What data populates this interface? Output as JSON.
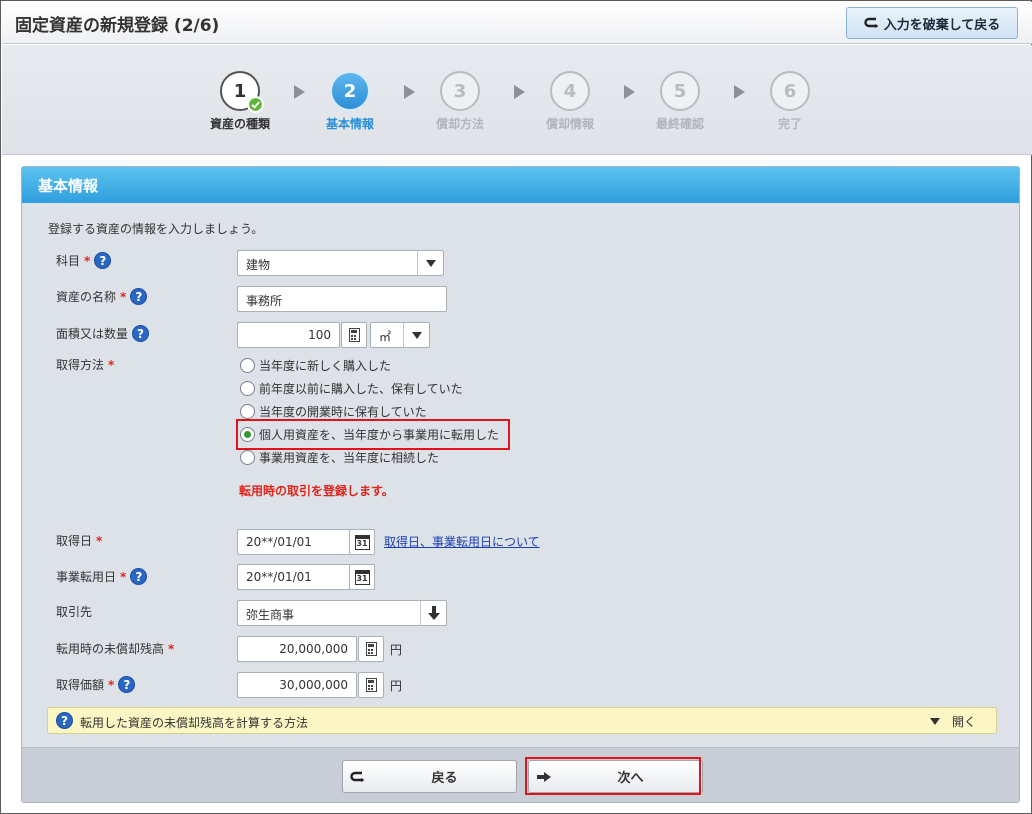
{
  "header": {
    "title": "固定資産の新規登録 (2/6)",
    "discard_label": "入力を破棄して戻る"
  },
  "steps": [
    {
      "num": "1",
      "label": "資産の種類",
      "state": "done"
    },
    {
      "num": "2",
      "label": "基本情報",
      "state": "active"
    },
    {
      "num": "3",
      "label": "償却方法",
      "state": "todo"
    },
    {
      "num": "4",
      "label": "償却情報",
      "state": "todo"
    },
    {
      "num": "5",
      "label": "最終確認",
      "state": "todo"
    },
    {
      "num": "6",
      "label": "完了",
      "state": "todo"
    }
  ],
  "panel": {
    "title": "基本情報",
    "intro": "登録する資産の情報を入力しましょう。"
  },
  "form": {
    "subject": {
      "label": "科目",
      "value": "建物"
    },
    "asset_name": {
      "label": "資産の名称",
      "value": "事務所"
    },
    "area": {
      "label": "面積又は数量",
      "value": "100",
      "unit": "㎡"
    },
    "acquisition_method": {
      "label": "取得方法",
      "options": [
        "当年度に新しく購入した",
        "前年度以前に購入した、保有していた",
        "当年度の開業時に保有していた",
        "個人用資産を、当年度から事業用に転用した",
        "事業用資産を、当年度に相続した"
      ],
      "selected_index": 3,
      "note": "転用時の取引を登録します。"
    },
    "acquisition_date": {
      "label": "取得日",
      "value": "20**/01/01",
      "link": "取得日、事業転用日について"
    },
    "conversion_date": {
      "label": "事業転用日",
      "value": "20**/01/01"
    },
    "partner": {
      "label": "取引先",
      "value": "弥生商事"
    },
    "unamortized": {
      "label": "転用時の未償却残高",
      "value": "20,000,000",
      "unit": "円"
    },
    "acquisition_price": {
      "label": "取得価額",
      "value": "30,000,000",
      "unit": "円"
    },
    "required_mark": "*",
    "help_mark": "?"
  },
  "accordion": {
    "text": "転用した資産の未償却残高を計算する方法",
    "toggle": "開く"
  },
  "footer": {
    "back_label": "戻る",
    "next_label": "次へ"
  },
  "colors": {
    "accent": "#2c8fd6",
    "highlight": "#e0141b",
    "required": "#e0251b",
    "selected_radio": "#2b9a2f"
  }
}
